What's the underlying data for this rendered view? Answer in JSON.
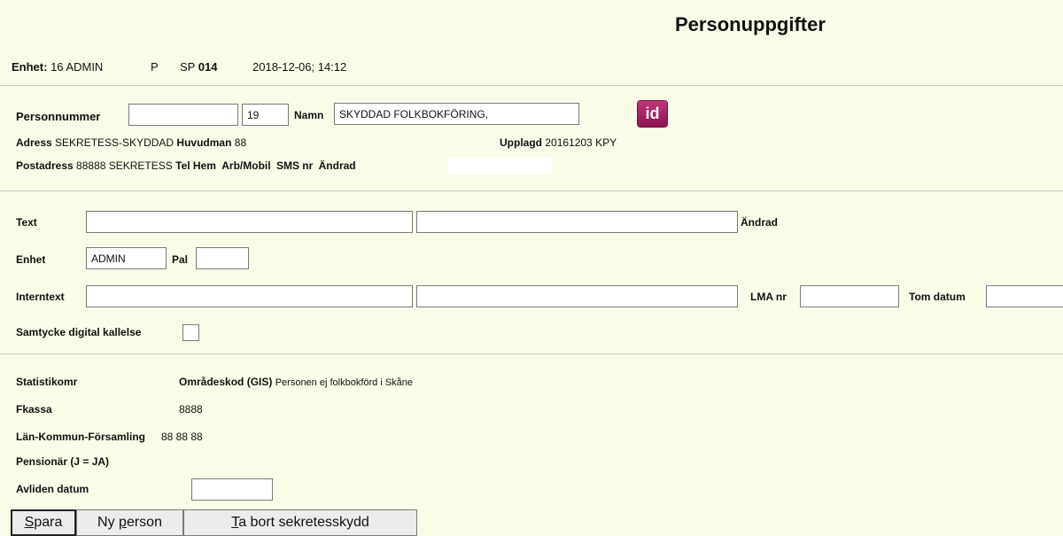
{
  "header": {
    "title": "Personuppgifter",
    "unit_label": "Enhet:",
    "unit_value": "16 ADMIN",
    "type": "P",
    "sp_label": "SP",
    "sp_value": "014",
    "datetime": "2018-12-06; 14:12"
  },
  "person": {
    "personnummer_label": "Personnummer",
    "personnummer_value": "",
    "century_value": "19",
    "namn_label": "Namn",
    "namn_value": "SKYDDAD FOLKBOKFÖRING,",
    "id_button_label": "id",
    "adress_label": "Adress",
    "adress_value": "SEKRETESS-SKYDDAD",
    "huvudman_label": "Huvudman",
    "huvudman_value": "88",
    "upplagd_label": "Upplagd",
    "upplagd_value": "20161203 KPY",
    "postadress_label": "Postadress",
    "postadress_value": "88888 SEKRETESS",
    "tel_hem_label": "Tel Hem",
    "arb_mobil_label": "Arb/Mobil",
    "sms_label": "SMS nr",
    "andrad_label": "Ändrad"
  },
  "notes": {
    "text_label": "Text",
    "text_value_1": "",
    "text_value_2": "",
    "andrad_label": "Ändrad",
    "enhet_label": "Enhet",
    "enhet_value": "ADMIN",
    "pal_label": "Pal",
    "pal_value": "",
    "interntext_label": "Interntext",
    "interntext_value_1": "",
    "interntext_value_2": "",
    "lma_label": "LMA nr",
    "lma_value": "",
    "tom_datum_label": "Tom datum",
    "tom_datum_value": "",
    "samtycke_label": "Samtycke digital kallelse",
    "samtycke_checked": false
  },
  "stats": {
    "statistikomr_label": "Statistikomr",
    "omradeskod_label": "Områdeskod (GIS)",
    "omradeskod_value": "Personen ej folkbokförd i Skåne",
    "fkassa_label": "Fkassa",
    "fkassa_value": "8888",
    "lkf_label": "Län-Kommun-Församling",
    "lkf_value": "88 88 88",
    "pensionar_label": "Pensionär (J = JA)",
    "avliden_label": "Avliden datum",
    "avliden_value": ""
  },
  "buttons": {
    "spara_key": "S",
    "spara_rest": "para",
    "ny_person_pre": "Ny ",
    "ny_person_key": "p",
    "ny_person_rest": "erson",
    "ta_bort_key": "T",
    "ta_bort_rest": "a bort sekretesskydd"
  }
}
